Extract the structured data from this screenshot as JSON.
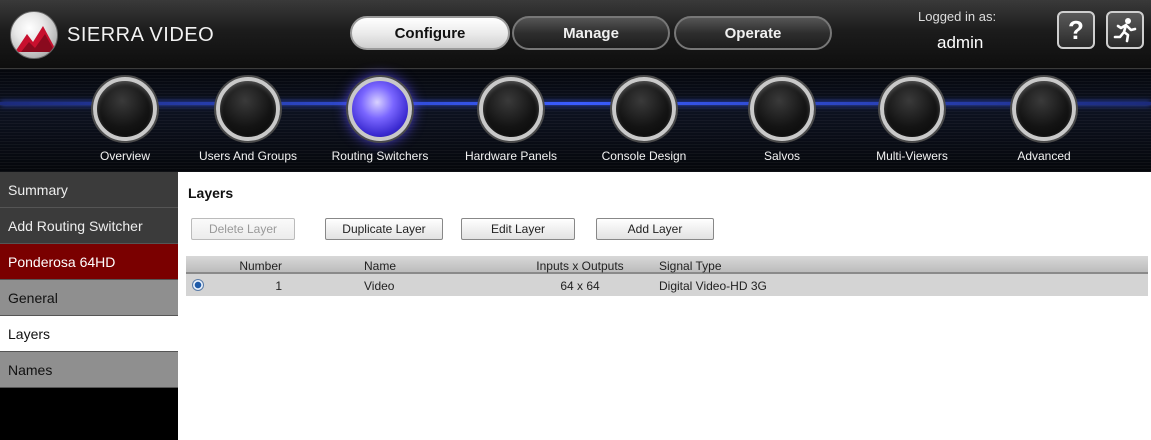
{
  "header": {
    "brand": "SIERRA VIDEO",
    "nav": [
      "Configure",
      "Manage",
      "Operate"
    ],
    "active_nav": "Configure",
    "login_label": "Logged in as:",
    "login_user": "admin",
    "help_glyph": "?"
  },
  "knobs": [
    {
      "label": "Overview",
      "selected": false
    },
    {
      "label": "Users And Groups",
      "selected": false
    },
    {
      "label": "Routing Switchers",
      "selected": true
    },
    {
      "label": "Hardware Panels",
      "selected": false
    },
    {
      "label": "Console Design",
      "selected": false
    },
    {
      "label": "Salvos",
      "selected": false
    },
    {
      "label": "Multi-Viewers",
      "selected": false
    },
    {
      "label": "Advanced",
      "selected": false
    }
  ],
  "sidebar": {
    "items": [
      {
        "label": "Summary"
      },
      {
        "label": "Add Routing Switcher"
      },
      {
        "label": "Ponderosa 64HD"
      },
      {
        "label": "General"
      },
      {
        "label": "Layers"
      },
      {
        "label": "Names"
      }
    ],
    "selected": "Layers"
  },
  "main": {
    "title": "Layers",
    "buttons": {
      "delete": "Delete Layer",
      "duplicate": "Duplicate Layer",
      "edit": "Edit Layer",
      "add": "Add Layer"
    },
    "columns": {
      "number": "Number",
      "name": "Name",
      "io": "Inputs x Outputs",
      "signal": "Signal Type"
    },
    "rows": [
      {
        "number": "1",
        "name": "Video",
        "io": "64 x 64",
        "signal": "Digital Video-HD 3G",
        "selected": true
      }
    ]
  },
  "colors": {
    "accent_blue": "#3a5cff",
    "sidebar_red": "#7a0000"
  },
  "icons": {
    "logo": "sierra-video-logo",
    "help": "help-icon",
    "logout": "running-person-icon"
  }
}
